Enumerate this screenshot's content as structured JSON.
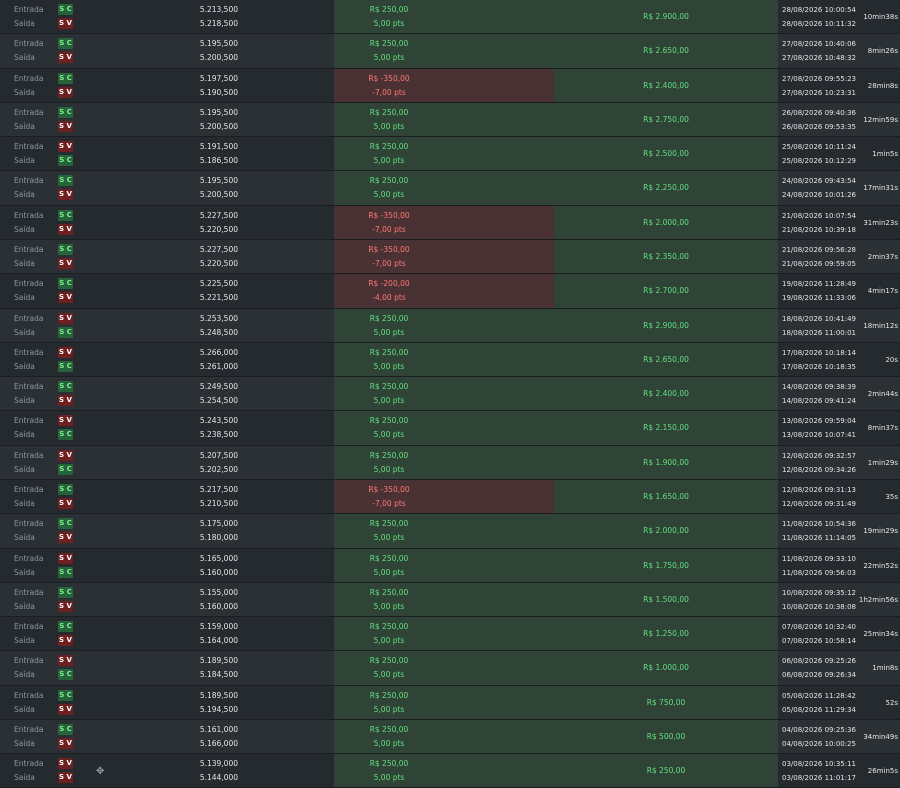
{
  "labels": {
    "entry": "Entrada",
    "exit": "Saída"
  },
  "trades": [
    {
      "o": "win",
      "e_side": "S C",
      "x_side": "S V",
      "e_price": "5.213,500",
      "x_price": "5.218,500",
      "result": "R$ 250,00",
      "points": "5,00 pts",
      "account": "R$ 2.900,00",
      "e_time": "28/08/2026 10:00:54",
      "x_time": "28/08/2026 10:11:32",
      "duration": "10min38s"
    },
    {
      "o": "win",
      "e_side": "S C",
      "x_side": "S V",
      "e_price": "5.195,500",
      "x_price": "5.200,500",
      "result": "R$ 250,00",
      "points": "5,00 pts",
      "account": "R$ 2.650,00",
      "e_time": "27/08/2026 10:40:06",
      "x_time": "27/08/2026 10:48:32",
      "duration": "8min26s"
    },
    {
      "o": "loss",
      "e_side": "S C",
      "x_side": "S V",
      "e_price": "5.197,500",
      "x_price": "5.190,500",
      "result": "R$ -350,00",
      "points": "-7,00 pts",
      "account": "R$ 2.400,00",
      "e_time": "27/08/2026 09:55:23",
      "x_time": "27/08/2026 10:23:31",
      "duration": "28min8s"
    },
    {
      "o": "win",
      "e_side": "S C",
      "x_side": "S V",
      "e_price": "5.195,500",
      "x_price": "5.200,500",
      "result": "R$ 250,00",
      "points": "5,00 pts",
      "account": "R$ 2.750,00",
      "e_time": "26/08/2026 09:40:36",
      "x_time": "26/08/2026 09:53:35",
      "duration": "12min59s"
    },
    {
      "o": "win",
      "e_side": "S V",
      "x_side": "S C",
      "e_price": "5.191,500",
      "x_price": "5.186,500",
      "result": "R$ 250,00",
      "points": "5,00 pts",
      "account": "R$ 2.500,00",
      "e_time": "25/08/2026 10:11:24",
      "x_time": "25/08/2026 10:12:29",
      "duration": "1min5s"
    },
    {
      "o": "win",
      "e_side": "S C",
      "x_side": "S V",
      "e_price": "5.195,500",
      "x_price": "5.200,500",
      "result": "R$ 250,00",
      "points": "5,00 pts",
      "account": "R$ 2.250,00",
      "e_time": "24/08/2026 09:43:54",
      "x_time": "24/08/2026 10:01:26",
      "duration": "17min31s"
    },
    {
      "o": "loss",
      "e_side": "S C",
      "x_side": "S V",
      "e_price": "5.227,500",
      "x_price": "5.220,500",
      "result": "R$ -350,00",
      "points": "-7,00 pts",
      "account": "R$ 2.000,00",
      "e_time": "21/08/2026 10:07:54",
      "x_time": "21/08/2026 10:39:18",
      "duration": "31min23s"
    },
    {
      "o": "loss",
      "e_side": "S C",
      "x_side": "S V",
      "e_price": "5.227,500",
      "x_price": "5.220,500",
      "result": "R$ -350,00",
      "points": "-7,00 pts",
      "account": "R$ 2.350,00",
      "e_time": "21/08/2026 09:56:28",
      "x_time": "21/08/2026 09:59:05",
      "duration": "2min37s"
    },
    {
      "o": "loss",
      "e_side": "S C",
      "x_side": "S V",
      "e_price": "5.225,500",
      "x_price": "5.221,500",
      "result": "R$ -200,00",
      "points": "-4,00 pts",
      "account": "R$ 2.700,00",
      "e_time": "19/08/2026 11:28:49",
      "x_time": "19/08/2026 11:33:06",
      "duration": "4min17s"
    },
    {
      "o": "win",
      "e_side": "S V",
      "x_side": "S C",
      "e_price": "5.253,500",
      "x_price": "5.248,500",
      "result": "R$ 250,00",
      "points": "5,00 pts",
      "account": "R$ 2.900,00",
      "e_time": "18/08/2026 10:41:49",
      "x_time": "18/08/2026 11:00:01",
      "duration": "18min12s"
    },
    {
      "o": "win",
      "e_side": "S V",
      "x_side": "S C",
      "e_price": "5.266,000",
      "x_price": "5.261,000",
      "result": "R$ 250,00",
      "points": "5,00 pts",
      "account": "R$ 2.650,00",
      "e_time": "17/08/2026 10:18:14",
      "x_time": "17/08/2026 10:18:35",
      "duration": "20s"
    },
    {
      "o": "win",
      "e_side": "S C",
      "x_side": "S V",
      "e_price": "5.249,500",
      "x_price": "5.254,500",
      "result": "R$ 250,00",
      "points": "5,00 pts",
      "account": "R$ 2.400,00",
      "e_time": "14/08/2026 09:38:39",
      "x_time": "14/08/2026 09:41:24",
      "duration": "2min44s"
    },
    {
      "o": "win",
      "e_side": "S V",
      "x_side": "S C",
      "e_price": "5.243,500",
      "x_price": "5.238,500",
      "result": "R$ 250,00",
      "points": "5,00 pts",
      "account": "R$ 2.150,00",
      "e_time": "13/08/2026 09:59:04",
      "x_time": "13/08/2026 10:07:41",
      "duration": "8min37s"
    },
    {
      "o": "win",
      "e_side": "S V",
      "x_side": "S C",
      "e_price": "5.207,500",
      "x_price": "5.202,500",
      "result": "R$ 250,00",
      "points": "5,00 pts",
      "account": "R$ 1.900,00",
      "e_time": "12/08/2026 09:32:57",
      "x_time": "12/08/2026 09:34:26",
      "duration": "1min29s"
    },
    {
      "o": "loss",
      "e_side": "S C",
      "x_side": "S V",
      "e_price": "5.217,500",
      "x_price": "5.210,500",
      "result": "R$ -350,00",
      "points": "-7,00 pts",
      "account": "R$ 1.650,00",
      "e_time": "12/08/2026 09:31:13",
      "x_time": "12/08/2026 09:31:49",
      "duration": "35s"
    },
    {
      "o": "win",
      "e_side": "S C",
      "x_side": "S V",
      "e_price": "5.175,000",
      "x_price": "5.180,000",
      "result": "R$ 250,00",
      "points": "5,00 pts",
      "account": "R$ 2.000,00",
      "e_time": "11/08/2026 10:54:36",
      "x_time": "11/08/2026 11:14:05",
      "duration": "19min29s"
    },
    {
      "o": "win",
      "e_side": "S V",
      "x_side": "S C",
      "e_price": "5.165,000",
      "x_price": "5.160,000",
      "result": "R$ 250,00",
      "points": "5,00 pts",
      "account": "R$ 1.750,00",
      "e_time": "11/08/2026 09:33:10",
      "x_time": "11/08/2026 09:56:03",
      "duration": "22min52s"
    },
    {
      "o": "win",
      "e_side": "S C",
      "x_side": "S V",
      "e_price": "5.155,000",
      "x_price": "5.160,000",
      "result": "R$ 250,00",
      "points": "5,00 pts",
      "account": "R$ 1.500,00",
      "e_time": "10/08/2026 09:35:12",
      "x_time": "10/08/2026 10:38:08",
      "duration": "1h2min56s"
    },
    {
      "o": "win",
      "e_side": "S C",
      "x_side": "S V",
      "e_price": "5.159,000",
      "x_price": "5.164,000",
      "result": "R$ 250,00",
      "points": "5,00 pts",
      "account": "R$ 1.250,00",
      "e_time": "07/08/2026 10:32:40",
      "x_time": "07/08/2026 10:58:14",
      "duration": "25min34s"
    },
    {
      "o": "win",
      "e_side": "S V",
      "x_side": "S C",
      "e_price": "5.189,500",
      "x_price": "5.184,500",
      "result": "R$ 250,00",
      "points": "5,00 pts",
      "account": "R$ 1.000,00",
      "e_time": "06/08/2026 09:25:26",
      "x_time": "06/08/2026 09:26:34",
      "duration": "1min8s"
    },
    {
      "o": "win",
      "e_side": "S C",
      "x_side": "S V",
      "e_price": "5.189,500",
      "x_price": "5.194,500",
      "result": "R$ 250,00",
      "points": "5,00 pts",
      "account": "R$ 750,00",
      "e_time": "05/08/2026 11:28:42",
      "x_time": "05/08/2026 11:29:34",
      "duration": "52s"
    },
    {
      "o": "win",
      "e_side": "S C",
      "x_side": "S V",
      "e_price": "5.161,000",
      "x_price": "5.166,000",
      "result": "R$ 250,00",
      "points": "5,00 pts",
      "account": "R$ 500,00",
      "e_time": "04/08/2026 09:25:36",
      "x_time": "04/08/2026 10:00:25",
      "duration": "34min49s"
    },
    {
      "o": "win",
      "e_side": "S V",
      "x_side": "S V",
      "e_price": "5.139,000",
      "x_price": "5.144,000",
      "result": "R$ 250,00",
      "points": "5,00 pts",
      "account": "R$ 250,00",
      "e_time": "03/08/2026 10:35:11",
      "x_time": "03/08/2026 11:01:17",
      "duration": "26min5s"
    }
  ]
}
